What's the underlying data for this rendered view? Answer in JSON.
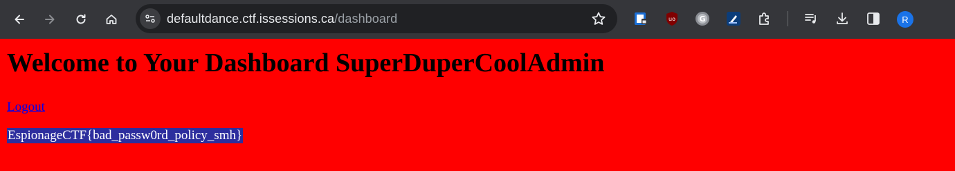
{
  "browser": {
    "url_host": "defaultdance.ctf.issessions.ca",
    "url_path": "/dashboard",
    "avatar_initial": "R",
    "icons": [
      "back-icon",
      "forward-icon",
      "reload-icon",
      "home-icon",
      "site-info-icon",
      "bookmark-star-icon",
      "extension-shield-icon",
      "ublock-icon",
      "grammarly-icon",
      "extension-icon",
      "extensions-puzzle-icon",
      "media-icon",
      "download-icon",
      "side-panel-icon"
    ]
  },
  "page": {
    "heading": "Welcome to Your Dashboard SuperDuperCoolAdmin",
    "logout_label": "Logout",
    "flag_text": "EspionageCTF{bad_passw0rd_policy_smh}",
    "background_color": "#ff0000"
  }
}
